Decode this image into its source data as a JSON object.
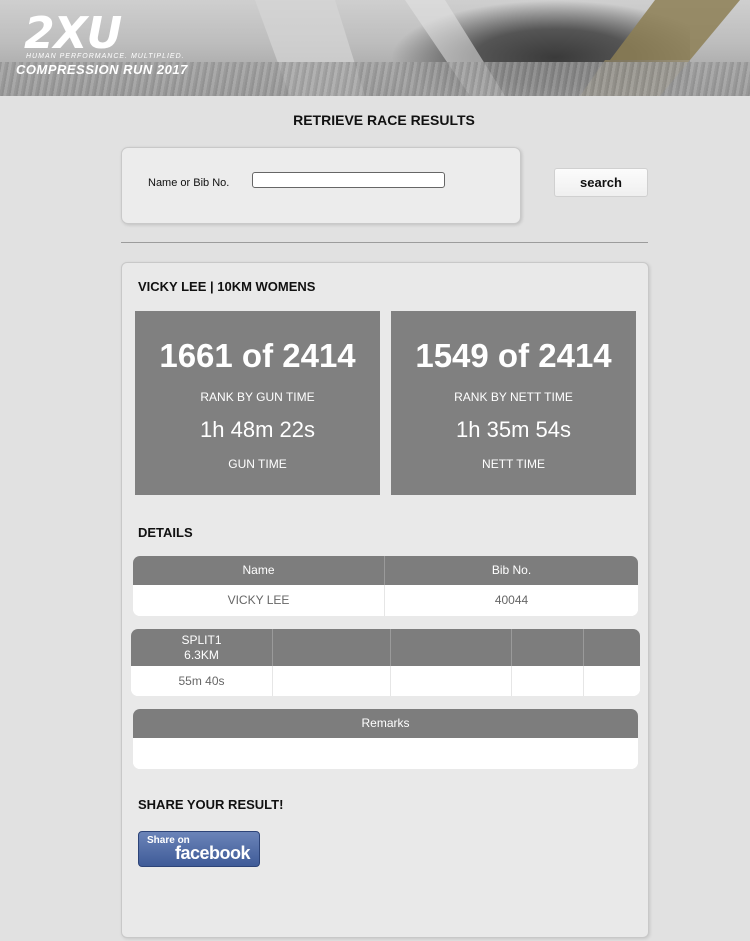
{
  "banner": {
    "logo_text": "2XU",
    "tagline": "HUMAN PERFORMANCE. MULTIPLIED.",
    "event_name": "COMPRESSION RUN 2017"
  },
  "page_title": "RETRIEVE RACE RESULTS",
  "search": {
    "label": "Name or Bib No.",
    "value": "",
    "placeholder": "",
    "button_label": "search"
  },
  "result": {
    "heading": "VICKY LEE | 10KM WOMENS",
    "gun": {
      "rank": "1661 of 2414",
      "rank_label": "RANK BY GUN TIME",
      "time": "1h 48m 22s",
      "time_label": "GUN TIME"
    },
    "nett": {
      "rank": "1549 of 2414",
      "rank_label": "RANK BY NETT TIME",
      "time": "1h 35m 54s",
      "time_label": "NETT TIME"
    }
  },
  "details": {
    "heading": "DETAILS",
    "columns": [
      "Name",
      "Bib No."
    ],
    "values": [
      "VICKY LEE",
      "40044"
    ]
  },
  "splits": {
    "headers": [
      {
        "line1": "SPLIT1",
        "line2": "6.3KM"
      },
      {
        "line1": "",
        "line2": ""
      },
      {
        "line1": "",
        "line2": ""
      },
      {
        "line1": "",
        "line2": ""
      },
      {
        "line1": "",
        "line2": ""
      }
    ],
    "values": [
      "55m 40s",
      "",
      "",
      "",
      ""
    ]
  },
  "remarks": {
    "header": "Remarks",
    "value": ""
  },
  "share": {
    "heading": "SHARE YOUR RESULT!",
    "fb_small": "Share on",
    "fb_big": "facebook"
  },
  "colors": {
    "page_bg": "#e1e1e1",
    "stat_box": "#808080",
    "table_header": "#7d7d7d",
    "facebook_blue": "#3f5b98"
  }
}
